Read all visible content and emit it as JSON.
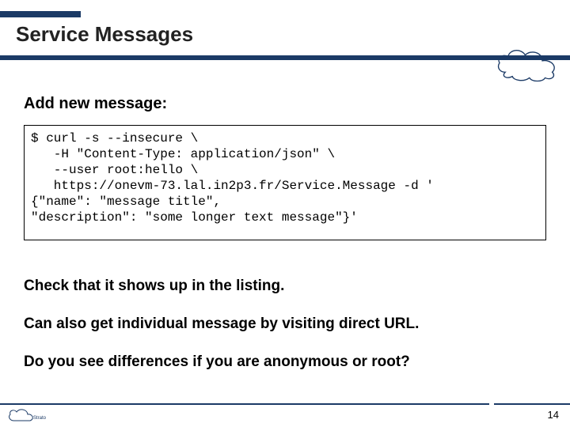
{
  "title": "Service Messages",
  "subheading": "Add new message:",
  "code_lines": [
    "$ curl -s --insecure \\",
    "   -H \"Content-Type: application/json\" \\",
    "   --user root:hello \\",
    "   https://onevm-73.lal.in2p3.fr/Service.Message -d '",
    "{\"name\": \"message title\",",
    "\"description\": \"some longer text message\"}'"
  ],
  "paragraphs": {
    "p1": "Check that it shows up in the listing.",
    "p2": "Can also get individual message by visiting direct URL.",
    "p3": "Do you see differences if you are anonymous or root?"
  },
  "page_number": "14"
}
